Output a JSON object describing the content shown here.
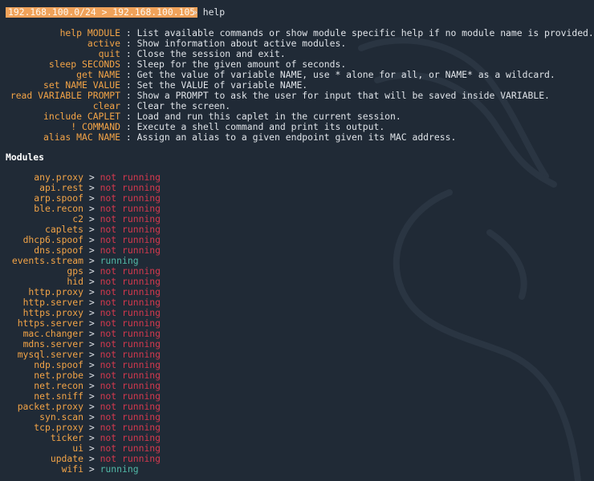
{
  "prompt": {
    "context": "192.168.100.0/24 > 192.168.100.105",
    "symbol": "»",
    "command": "help"
  },
  "help": [
    {
      "cmd": "help MODULE",
      "desc": "List available commands or show module specific help if no module name is provided."
    },
    {
      "cmd": "active",
      "desc": "Show information about active modules."
    },
    {
      "cmd": "quit",
      "desc": "Close the session and exit."
    },
    {
      "cmd": "sleep SECONDS",
      "desc": "Sleep for the given amount of seconds."
    },
    {
      "cmd": "get NAME",
      "desc": "Get the value of variable NAME, use * alone for all, or NAME* as a wildcard."
    },
    {
      "cmd": "set NAME VALUE",
      "desc": "Set the VALUE of variable NAME."
    },
    {
      "cmd": "read VARIABLE PROMPT",
      "desc": "Show a PROMPT to ask the user for input that will be saved inside VARIABLE."
    },
    {
      "cmd": "clear",
      "desc": "Clear the screen."
    },
    {
      "cmd": "include CAPLET",
      "desc": "Load and run this caplet in the current session."
    },
    {
      "cmd": "! COMMAND",
      "desc": "Execute a shell command and print its output."
    },
    {
      "cmd": "alias MAC NAME",
      "desc": "Assign an alias to a given endpoint given its MAC address."
    }
  ],
  "modules_heading": "Modules",
  "modules": [
    {
      "name": "any.proxy",
      "status": "not running"
    },
    {
      "name": "api.rest",
      "status": "not running"
    },
    {
      "name": "arp.spoof",
      "status": "not running"
    },
    {
      "name": "ble.recon",
      "status": "not running"
    },
    {
      "name": "c2",
      "status": "not running"
    },
    {
      "name": "caplets",
      "status": "not running"
    },
    {
      "name": "dhcp6.spoof",
      "status": "not running"
    },
    {
      "name": "dns.spoof",
      "status": "not running"
    },
    {
      "name": "events.stream",
      "status": "running"
    },
    {
      "name": "gps",
      "status": "not running"
    },
    {
      "name": "hid",
      "status": "not running"
    },
    {
      "name": "http.proxy",
      "status": "not running"
    },
    {
      "name": "http.server",
      "status": "not running"
    },
    {
      "name": "https.proxy",
      "status": "not running"
    },
    {
      "name": "https.server",
      "status": "not running"
    },
    {
      "name": "mac.changer",
      "status": "not running"
    },
    {
      "name": "mdns.server",
      "status": "not running"
    },
    {
      "name": "mysql.server",
      "status": "not running"
    },
    {
      "name": "ndp.spoof",
      "status": "not running"
    },
    {
      "name": "net.probe",
      "status": "not running"
    },
    {
      "name": "net.recon",
      "status": "not running"
    },
    {
      "name": "net.sniff",
      "status": "not running"
    },
    {
      "name": "packet.proxy",
      "status": "not running"
    },
    {
      "name": "syn.scan",
      "status": "not running"
    },
    {
      "name": "tcp.proxy",
      "status": "not running"
    },
    {
      "name": "ticker",
      "status": "not running"
    },
    {
      "name": "ui",
      "status": "not running"
    },
    {
      "name": "update",
      "status": "not running"
    },
    {
      "name": "wifi",
      "status": "running"
    }
  ],
  "colors": {
    "background": "#202a36",
    "prompt_bg": "#f0a25a",
    "command": "#f3a447",
    "not_running": "#d4394e",
    "running": "#51b8a6"
  }
}
